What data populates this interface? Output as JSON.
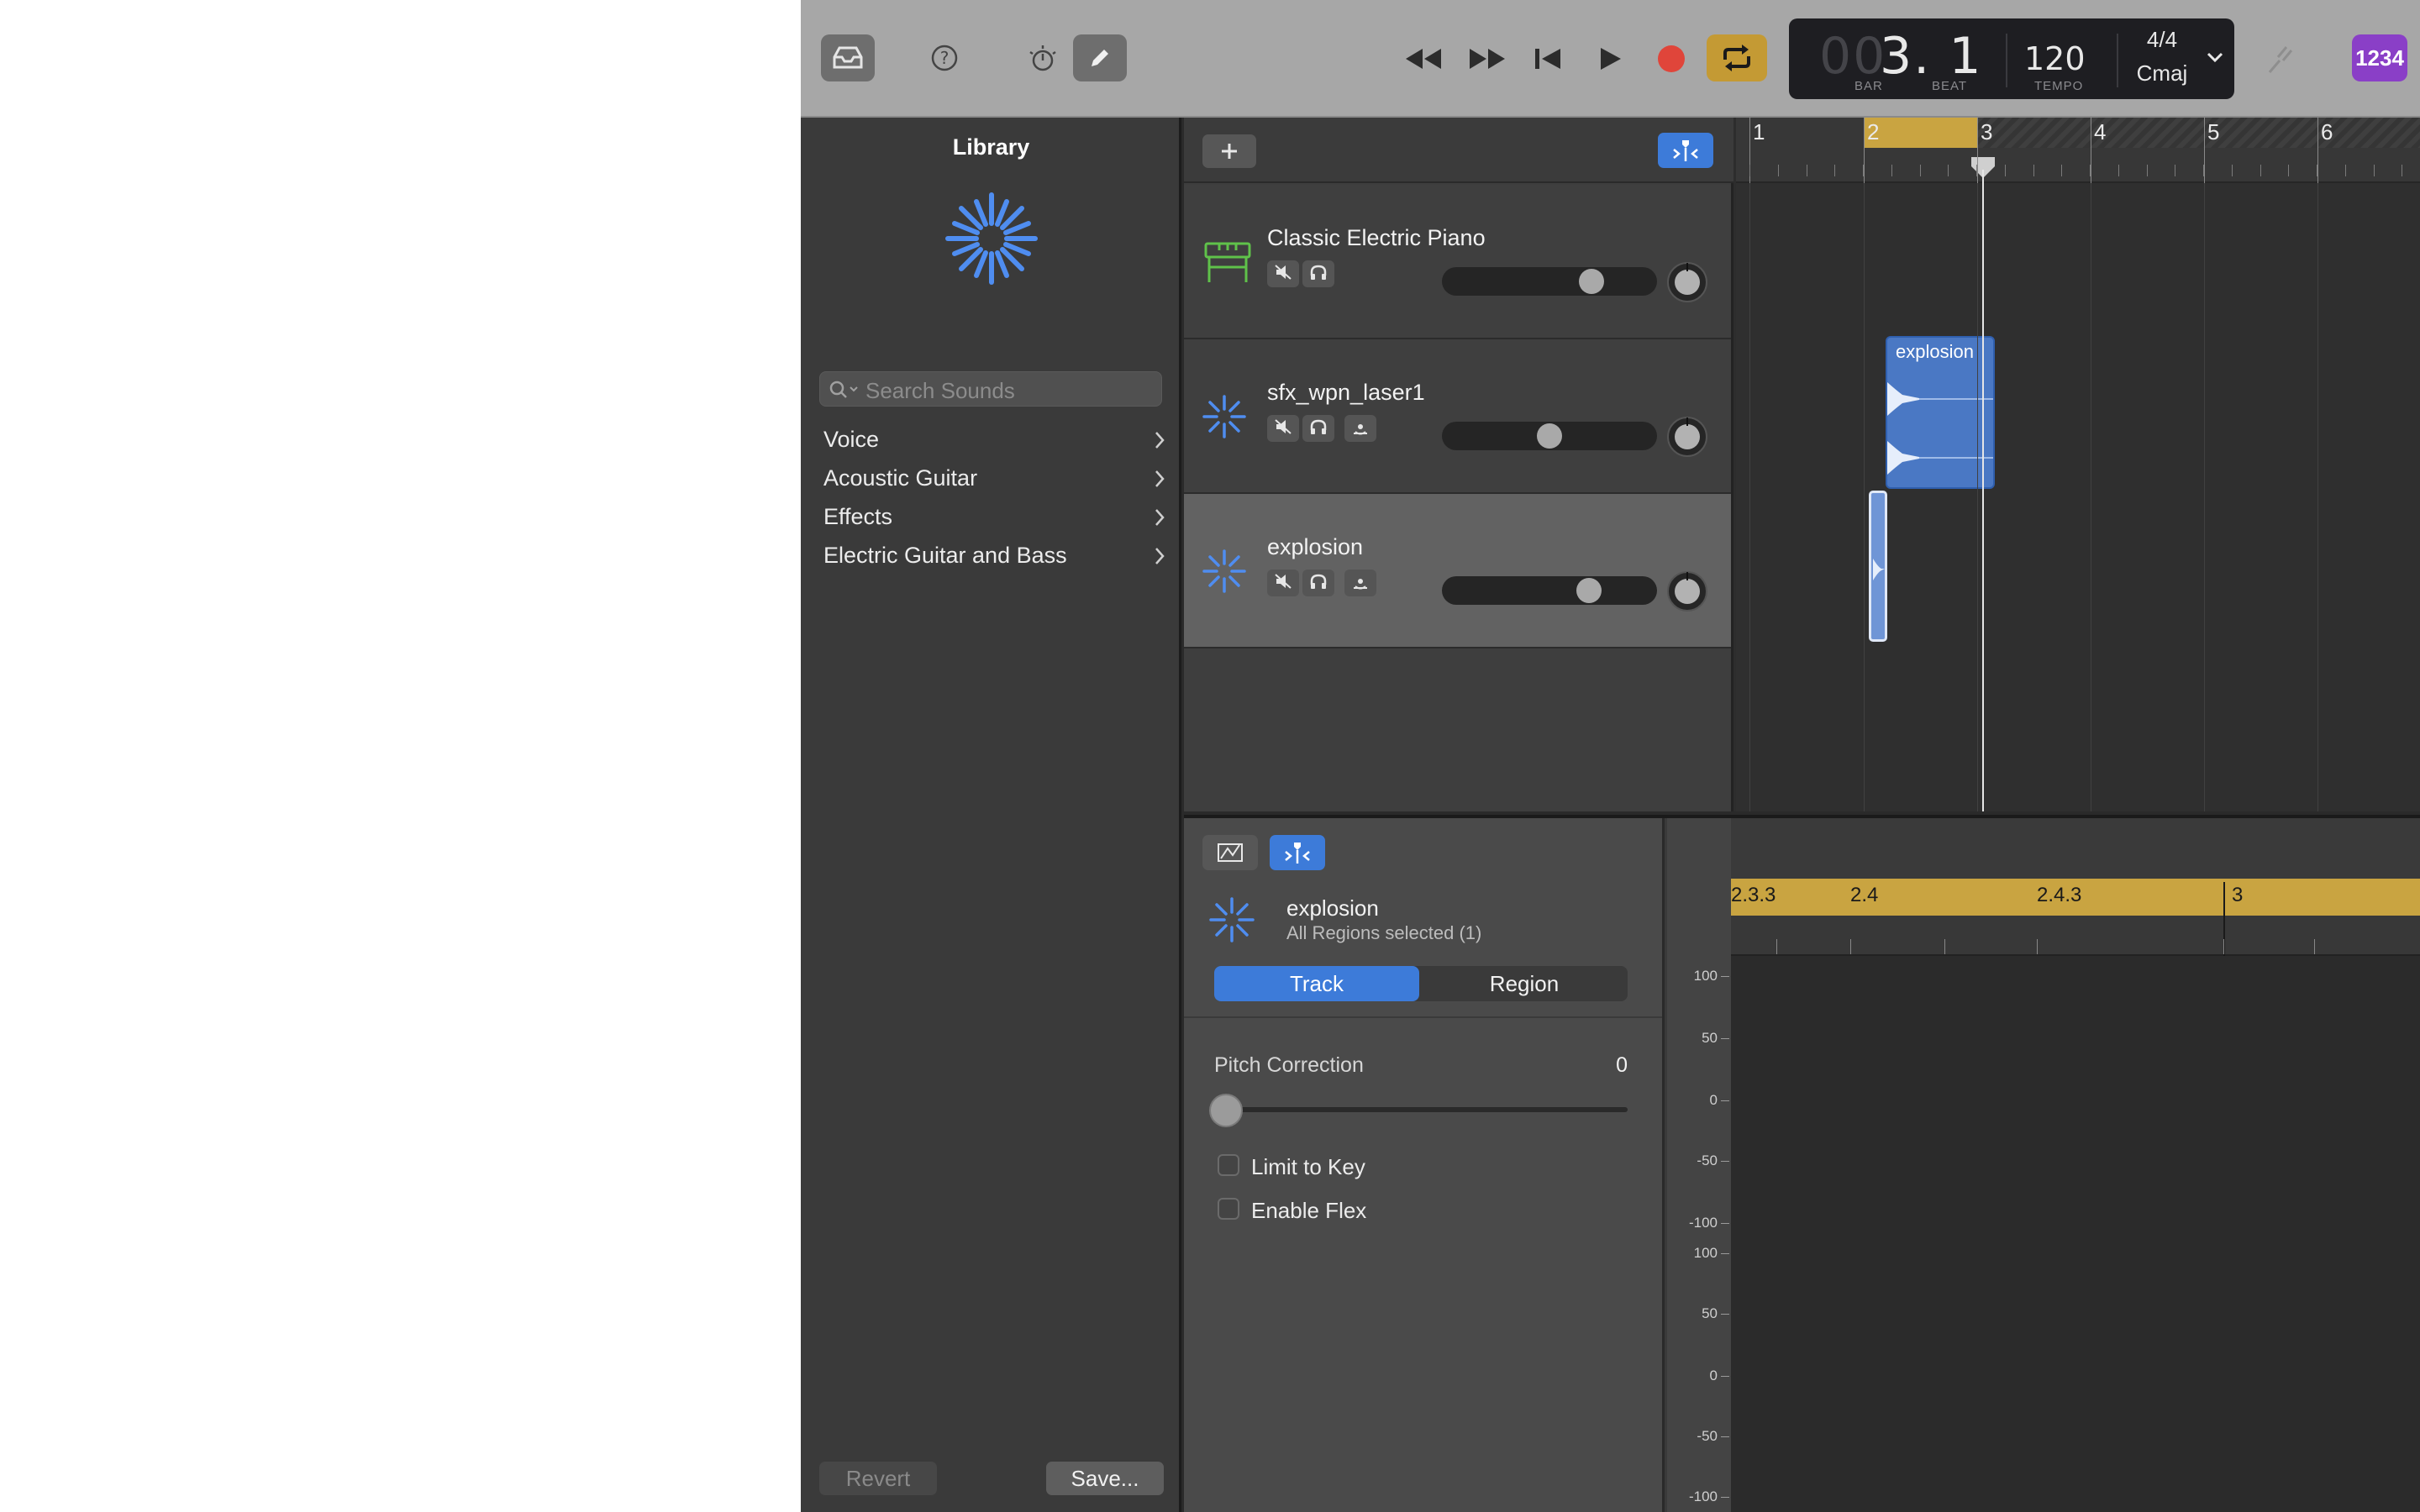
{
  "toolbar": {
    "buttons": [
      {
        "name": "library-button",
        "icon": "tray-icon"
      },
      {
        "name": "help-button",
        "icon": "question-icon"
      },
      {
        "name": "smart-controls-button",
        "icon": "dial-icon"
      },
      {
        "name": "editors-button",
        "icon": "pencil-icon"
      }
    ],
    "transport": [
      "rewind-icon",
      "fast-forward-icon",
      "go-to-start-icon",
      "play-icon",
      "record-icon",
      "cycle-icon"
    ],
    "lcd": {
      "position_dim": "00",
      "position": "3. 1",
      "bar_label": "BAR",
      "beat_label": "BEAT",
      "tempo": "120",
      "tempo_label": "TEMPO",
      "time_signature": "4/4",
      "key": "Cmaj"
    },
    "count_in": "1234",
    "colors": {
      "record": "#e0453a",
      "cycle": "#c49a34",
      "count_in": "#8a3fc7",
      "accent": "#3d7bd9"
    }
  },
  "library": {
    "title": "Library",
    "search_placeholder": "Search Sounds",
    "items": [
      {
        "label": "Voice"
      },
      {
        "label": "Acoustic Guitar"
      },
      {
        "label": "Effects"
      },
      {
        "label": "Electric Guitar and Bass"
      }
    ],
    "revert_label": "Revert",
    "save_label": "Save..."
  },
  "ruler": {
    "bars": [
      "1",
      "2",
      "3",
      "4",
      "5",
      "6"
    ]
  },
  "tracks": [
    {
      "name": "Classic Electric Piano",
      "icon": "keyboard-icon",
      "volume": 0.72
    },
    {
      "name": "sfx_wpn_laser1",
      "icon": "waveform-burst-icon",
      "volume": 0.5
    },
    {
      "name": "explosion",
      "icon": "waveform-burst-icon",
      "volume": 0.71,
      "selected": true
    }
  ],
  "regions": [
    {
      "label": "explosion",
      "track": 1
    }
  ],
  "editor": {
    "track_name": "explosion",
    "subtitle": "All Regions selected (1)",
    "tabs": [
      {
        "label": "Track",
        "active": true
      },
      {
        "label": "Region",
        "active": false
      }
    ],
    "pitch_correction_label": "Pitch Correction",
    "pitch_correction_value": "0",
    "limit_to_key_label": "Limit to Key",
    "enable_flex_label": "Enable Flex",
    "ruler_labels": [
      "2.3.3",
      "2.4",
      "2.4.3",
      "3"
    ],
    "y_axis_top": [
      "100",
      "50",
      "0",
      "-50",
      "-100"
    ],
    "y_axis_bottom": [
      "100",
      "50",
      "0",
      "-50",
      "-100"
    ]
  }
}
